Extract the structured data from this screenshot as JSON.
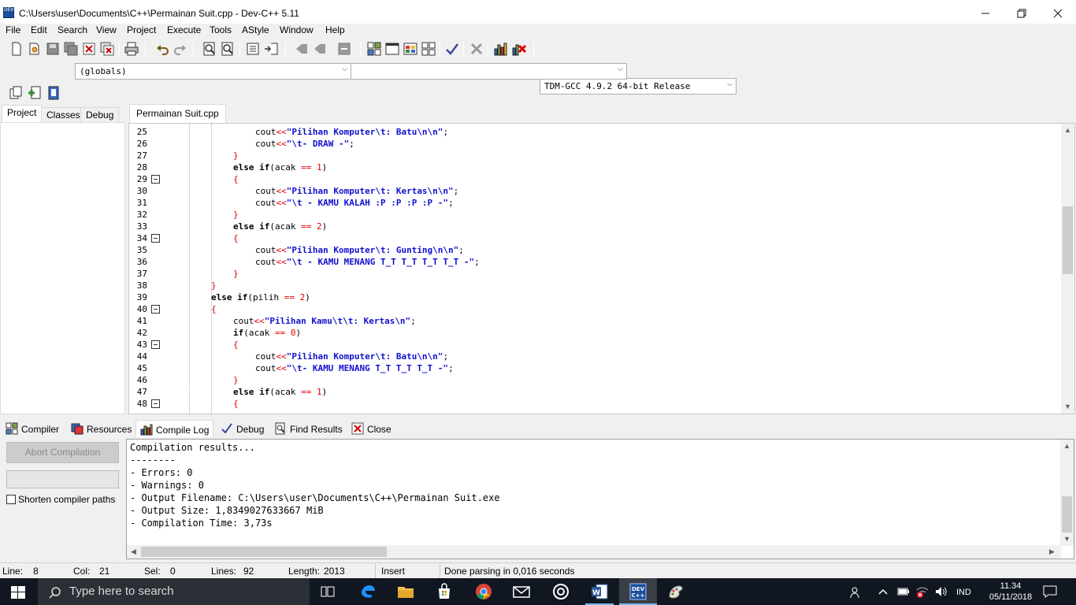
{
  "window": {
    "title": "C:\\Users\\user\\Documents\\C++\\Permainan Suit.cpp - Dev-C++ 5.11",
    "app_icon_text": "DEV",
    "controls": [
      "minimize-icon",
      "restore-icon",
      "close-icon"
    ]
  },
  "menu": [
    "File",
    "Edit",
    "Search",
    "View",
    "Project",
    "Execute",
    "Tools",
    "AStyle",
    "Window",
    "Help"
  ],
  "toolbar": {
    "compiler": "TDM-GCC 4.9.2 64-bit Release",
    "globals": "(globals)",
    "scope": ""
  },
  "left_tabs": [
    "Project",
    "Classes",
    "Debug"
  ],
  "editor": {
    "tab": "Permainan Suit.cpp",
    "lines": [
      {
        "n": "25",
        "fold": false,
        "indent": 4,
        "tokens": [
          [
            "p",
            "cout"
          ],
          [
            "o",
            "<<"
          ],
          [
            "s",
            "\"Pilihan Komputer\\t: Batu\\n\\n\""
          ],
          [
            "p",
            ";"
          ]
        ]
      },
      {
        "n": "26",
        "fold": false,
        "indent": 4,
        "tokens": [
          [
            "p",
            "cout"
          ],
          [
            "o",
            "<<"
          ],
          [
            "s",
            "\"\\t- DRAW -\""
          ],
          [
            "p",
            ";"
          ]
        ]
      },
      {
        "n": "27",
        "fold": false,
        "indent": 3,
        "tokens": [
          [
            "o",
            "}"
          ]
        ]
      },
      {
        "n": "28",
        "fold": false,
        "indent": 3,
        "tokens": [
          [
            "k",
            "else if"
          ],
          [
            "p",
            "(acak "
          ],
          [
            "o",
            "=="
          ],
          [
            "p",
            " "
          ],
          [
            "n",
            "1"
          ],
          [
            "p",
            ")"
          ]
        ]
      },
      {
        "n": "29",
        "fold": true,
        "indent": 3,
        "tokens": [
          [
            "o",
            "{"
          ]
        ]
      },
      {
        "n": "30",
        "fold": false,
        "indent": 4,
        "tokens": [
          [
            "p",
            "cout"
          ],
          [
            "o",
            "<<"
          ],
          [
            "s",
            "\"Pilihan Komputer\\t: Kertas\\n\\n\""
          ],
          [
            "p",
            ";"
          ]
        ]
      },
      {
        "n": "31",
        "fold": false,
        "indent": 4,
        "tokens": [
          [
            "p",
            "cout"
          ],
          [
            "o",
            "<<"
          ],
          [
            "s",
            "\"\\t - KAMU KALAH :P :P :P :P -\""
          ],
          [
            "p",
            ";"
          ]
        ]
      },
      {
        "n": "32",
        "fold": false,
        "indent": 3,
        "tokens": [
          [
            "o",
            "}"
          ]
        ]
      },
      {
        "n": "33",
        "fold": false,
        "indent": 3,
        "tokens": [
          [
            "k",
            "else if"
          ],
          [
            "p",
            "(acak "
          ],
          [
            "o",
            "=="
          ],
          [
            "p",
            " "
          ],
          [
            "n",
            "2"
          ],
          [
            "p",
            ")"
          ]
        ]
      },
      {
        "n": "34",
        "fold": true,
        "indent": 3,
        "tokens": [
          [
            "o",
            "{"
          ]
        ]
      },
      {
        "n": "35",
        "fold": false,
        "indent": 4,
        "tokens": [
          [
            "p",
            "cout"
          ],
          [
            "o",
            "<<"
          ],
          [
            "s",
            "\"Pilihan Komputer\\t: Gunting\\n\\n\""
          ],
          [
            "p",
            ";"
          ]
        ]
      },
      {
        "n": "36",
        "fold": false,
        "indent": 4,
        "tokens": [
          [
            "p",
            "cout"
          ],
          [
            "o",
            "<<"
          ],
          [
            "s",
            "\"\\t - KAMU MENANG T_T T_T T_T T_T -\""
          ],
          [
            "p",
            ";"
          ]
        ]
      },
      {
        "n": "37",
        "fold": false,
        "indent": 3,
        "tokens": [
          [
            "o",
            "}"
          ]
        ]
      },
      {
        "n": "38",
        "fold": false,
        "indent": 2,
        "tokens": [
          [
            "o",
            "}"
          ]
        ]
      },
      {
        "n": "39",
        "fold": false,
        "indent": 2,
        "tokens": [
          [
            "k",
            "else if"
          ],
          [
            "p",
            "(pilih "
          ],
          [
            "o",
            "=="
          ],
          [
            "p",
            " "
          ],
          [
            "n",
            "2"
          ],
          [
            "p",
            ")"
          ]
        ]
      },
      {
        "n": "40",
        "fold": true,
        "indent": 2,
        "tokens": [
          [
            "o",
            "{"
          ]
        ]
      },
      {
        "n": "41",
        "fold": false,
        "indent": 3,
        "tokens": [
          [
            "p",
            "cout"
          ],
          [
            "o",
            "<<"
          ],
          [
            "s",
            "\"Pilihan Kamu\\t\\t: Kertas\\n\""
          ],
          [
            "p",
            ";"
          ]
        ]
      },
      {
        "n": "42",
        "fold": false,
        "indent": 3,
        "tokens": [
          [
            "k",
            "if"
          ],
          [
            "p",
            "(acak "
          ],
          [
            "o",
            "=="
          ],
          [
            "p",
            " "
          ],
          [
            "n",
            "0"
          ],
          [
            "p",
            ")"
          ]
        ]
      },
      {
        "n": "43",
        "fold": true,
        "indent": 3,
        "tokens": [
          [
            "o",
            "{"
          ]
        ]
      },
      {
        "n": "44",
        "fold": false,
        "indent": 4,
        "tokens": [
          [
            "p",
            "cout"
          ],
          [
            "o",
            "<<"
          ],
          [
            "s",
            "\"Pilihan Komputer\\t: Batu\\n\\n\""
          ],
          [
            "p",
            ";"
          ]
        ]
      },
      {
        "n": "45",
        "fold": false,
        "indent": 4,
        "tokens": [
          [
            "p",
            "cout"
          ],
          [
            "o",
            "<<"
          ],
          [
            "s",
            "\"\\t- KAMU MENANG T_T T_T T_T -\""
          ],
          [
            "p",
            ";"
          ]
        ]
      },
      {
        "n": "46",
        "fold": false,
        "indent": 3,
        "tokens": [
          [
            "o",
            "}"
          ]
        ]
      },
      {
        "n": "47",
        "fold": false,
        "indent": 3,
        "tokens": [
          [
            "k",
            "else if"
          ],
          [
            "p",
            "(acak "
          ],
          [
            "o",
            "=="
          ],
          [
            "p",
            " "
          ],
          [
            "n",
            "1"
          ],
          [
            "p",
            ")"
          ]
        ]
      },
      {
        "n": "48",
        "fold": true,
        "indent": 3,
        "tokens": [
          [
            "o",
            "{"
          ]
        ]
      }
    ]
  },
  "bottom_tabs": [
    "Compiler",
    "Resources",
    "Compile Log",
    "Debug",
    "Find Results",
    "Close"
  ],
  "compile_panel": {
    "abort_label": "Abort Compilation",
    "shorten_label": "Shorten compiler paths",
    "shorten_checked": false,
    "log": [
      "Compilation results...",
      "--------",
      "- Errors: 0",
      "- Warnings: 0",
      "- Output Filename: C:\\Users\\user\\Documents\\C++\\Permainan Suit.exe",
      "- Output Size: 1,8349027633667 MiB",
      "- Compilation Time: 3,73s"
    ]
  },
  "status": {
    "line_label": "Line:",
    "line": "8",
    "col_label": "Col:",
    "col": "21",
    "sel_label": "Sel:",
    "sel": "0",
    "lines_label": "Lines:",
    "lines": "92",
    "length_label": "Length:",
    "length": "2013",
    "mode": "Insert",
    "message": "Done parsing in 0,016 seconds"
  },
  "taskbar": {
    "search_placeholder": "Type here to search",
    "lang": "IND",
    "time": "11.34",
    "date": "05/11/2018"
  },
  "colors": {
    "keyword": "#000000",
    "string": "#1010d0",
    "number": "#e00000",
    "operator": "#e00000"
  }
}
